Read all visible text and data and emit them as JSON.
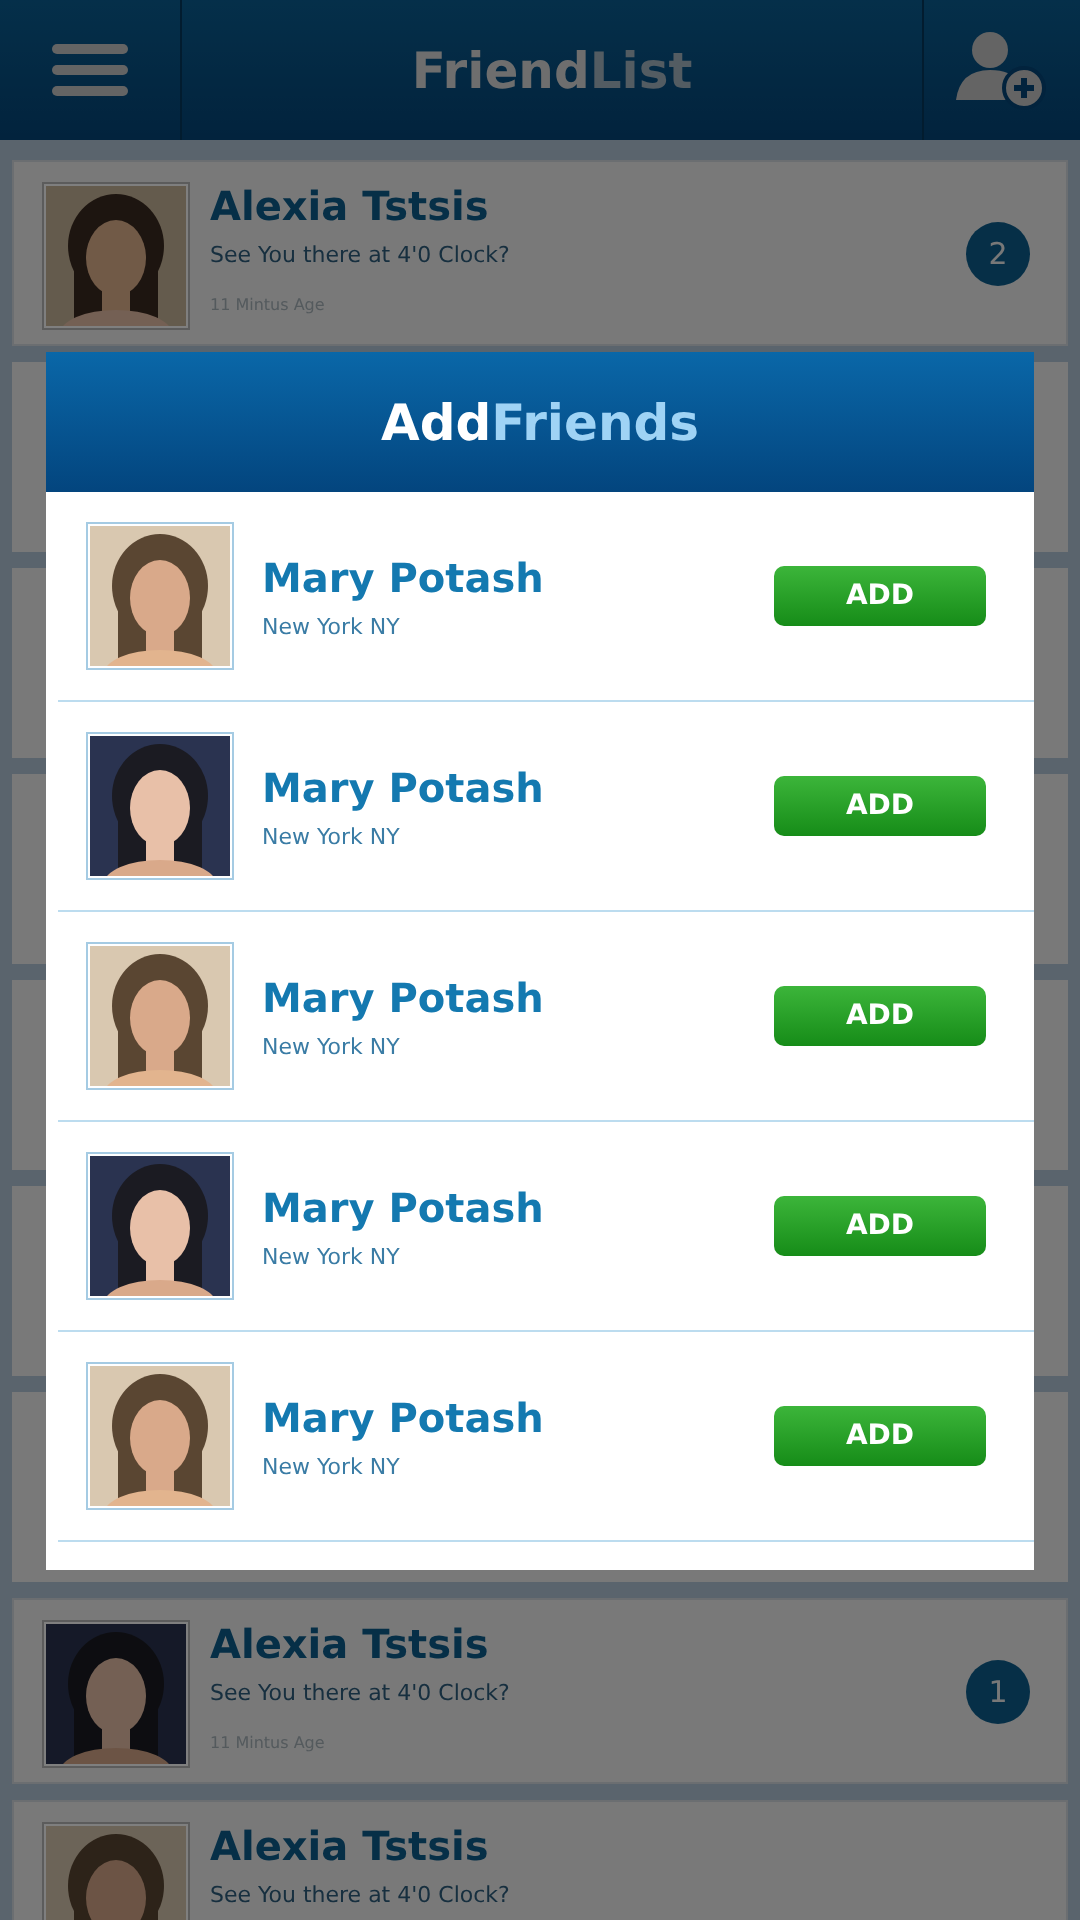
{
  "header": {
    "title_parts": [
      "Friend",
      "List"
    ]
  },
  "friends": [
    {
      "name": "Alexia Tstsis",
      "message": "See You there at 4'0 Clock?",
      "time": "11 Mintus Age",
      "badge": "2"
    },
    {
      "name": "Alexia Tstsis",
      "message": "See You there at 4'0 Clock?",
      "time": "11 Mintus Age",
      "badge": "1"
    },
    {
      "name": "Alexia Tstsis",
      "message": "See You there at 4'0 Clock?"
    }
  ],
  "dialog": {
    "title_parts": [
      "Add",
      "Friends"
    ],
    "people": [
      {
        "name": "Mary Potash",
        "location": "New York NY",
        "button": "ADD"
      },
      {
        "name": "Mary Potash",
        "location": "New York NY",
        "button": "ADD"
      },
      {
        "name": "Mary Potash",
        "location": "New York NY",
        "button": "ADD"
      },
      {
        "name": "Mary Potash",
        "location": "New York NY",
        "button": "ADD"
      },
      {
        "name": "Mary Potash",
        "location": "New York NY",
        "button": "ADD"
      }
    ]
  }
}
